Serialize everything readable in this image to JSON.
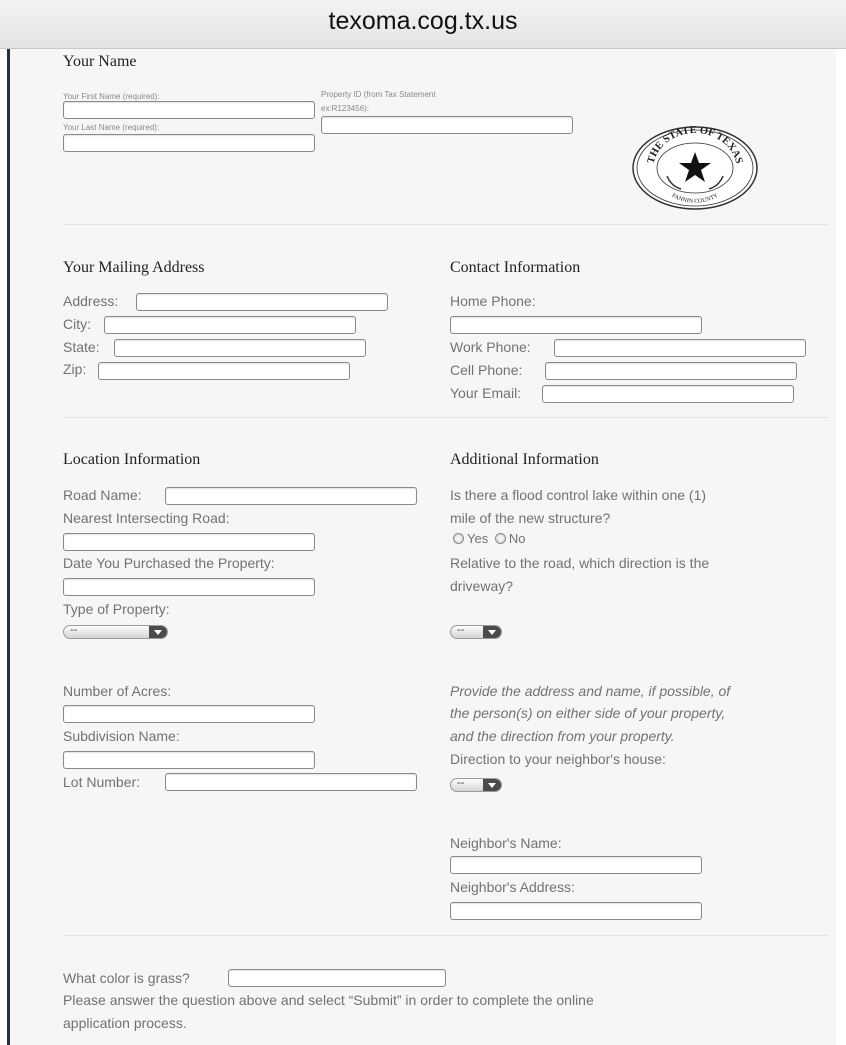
{
  "browser": {
    "url": "texoma.cog.tx.us"
  },
  "name_section": {
    "heading": "Your Name",
    "first_name_label": "Your First Name (required):",
    "last_name_label": "Your Last Name (required):",
    "property_id_label_1": "Property ID (from Tax Statement",
    "property_id_label_2": "ex:R123456):",
    "first_name_value": "",
    "last_name_value": "",
    "property_id_value": ""
  },
  "seal": {
    "top_text": "THE STATE OF TEXAS",
    "bottom_text": "FANNIN COUNTY"
  },
  "mailing": {
    "heading": "Your Mailing Address",
    "address_label": "Address:",
    "city_label": "City:",
    "state_label": "State:",
    "zip_label": "Zip:"
  },
  "contact": {
    "heading": "Contact Information",
    "home_phone_label": "Home Phone:",
    "work_phone_label": "Work Phone:",
    "cell_phone_label": "Cell Phone:",
    "email_label": "Your Email:"
  },
  "location": {
    "heading": "Location Information",
    "road_name_label": "Road Name:",
    "intersecting_label": "Nearest Intersecting Road:",
    "date_purchased_label": "Date You Purchased the Property:",
    "type_label": "Type of Property:",
    "type_selected": "--",
    "acres_label": "Number of Acres:",
    "subdivision_label": "Subdivision Name:",
    "lot_label": "Lot Number:"
  },
  "additional": {
    "heading": "Additional Information",
    "flood_q_1": "Is there a flood control lake within one (1)",
    "flood_q_2": "mile of the new structure?",
    "yes_label": "Yes",
    "no_label": "No",
    "driveway_q_1": "Relative to the road, which direction is the",
    "driveway_q_2": "driveway?",
    "driveway_selected": "--",
    "neighbor_note_1": "Provide the address and name, if possible, of",
    "neighbor_note_2": "the person(s) on either side of your property,",
    "neighbor_note_3": "and the direction from your property.",
    "neighbor_dir_label": "Direction to your neighbor's house:",
    "neighbor_dir_selected": "--",
    "neighbor_name_label": "Neighbor's Name:",
    "neighbor_address_label": "Neighbor's Address:"
  },
  "captcha": {
    "question": "What color is grass?",
    "instructions_1": "Please answer the question above and select “Submit” in order to complete the online",
    "instructions_2": "application process."
  }
}
